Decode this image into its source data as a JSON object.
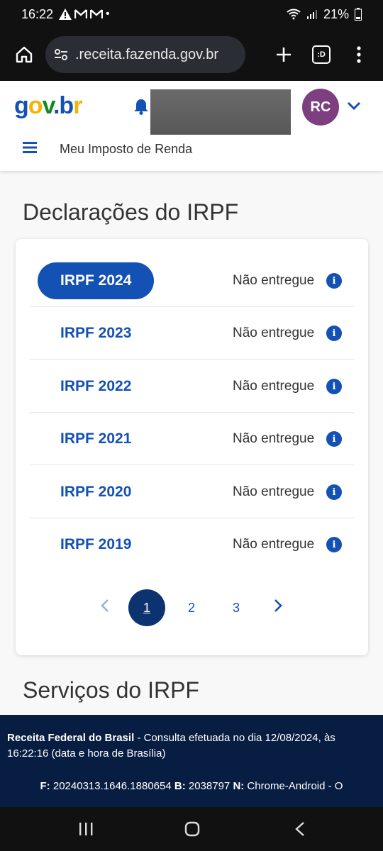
{
  "status_bar": {
    "time": "16:22",
    "notification_icons": [
      "warning-icon",
      "gmail-icon",
      "gmail-icon",
      "dot-icon"
    ],
    "battery": "21%"
  },
  "browser": {
    "url": ".receita.fazenda.gov.br",
    "tab_count": ":D"
  },
  "header": {
    "logo": "gov.br",
    "avatar_initials": "RC",
    "site_title": "Meu Imposto de Renda",
    "brand_color": "#1351b4",
    "avatar_color": "#7d3f80"
  },
  "declarations": {
    "title": "Declarações do IRPF",
    "rows": [
      {
        "year": "IRPF 2024",
        "status": "Não entregue",
        "active": true
      },
      {
        "year": "IRPF 2023",
        "status": "Não entregue",
        "active": false
      },
      {
        "year": "IRPF 2022",
        "status": "Não entregue",
        "active": false
      },
      {
        "year": "IRPF 2021",
        "status": "Não entregue",
        "active": false
      },
      {
        "year": "IRPF 2020",
        "status": "Não entregue",
        "active": false
      },
      {
        "year": "IRPF 2019",
        "status": "Não entregue",
        "active": false
      }
    ],
    "pagination": {
      "pages": [
        "1",
        "2",
        "3"
      ],
      "current": "1"
    }
  },
  "services": {
    "title": "Serviços do IRPF"
  },
  "footer": {
    "org": "Receita Federal do Brasil",
    "consult_text": " - Consulta efetuada no dia 12/08/2024, às 16:22:16 (data e hora de Brasília)",
    "f_label": "F:",
    "f_value": " 20240313.1646.1880654 ",
    "b_label": "B:",
    "b_value": " 2038797 ",
    "n_label": "N:",
    "n_value": " Chrome-Android - O",
    "background": "#071d41"
  }
}
